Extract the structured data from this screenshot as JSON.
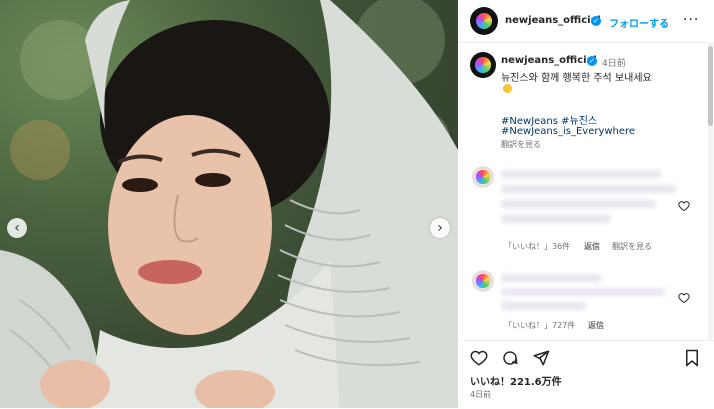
{
  "post": {
    "username": "newjeans_official",
    "follow_label": "フォローする",
    "more_label": "···",
    "caption_time": "4日前",
    "caption_text": "뉴진스와 함께 행복한 주석 보내세요",
    "hashtags_line1": "#NewJeans #뉴진스",
    "hashtags_line2": "#NewJeans_is_Everywhere",
    "translate_label": "翻訳を見る",
    "likes": "いいね！221.6万件",
    "date": "4日前"
  },
  "comments": [
    {
      "likes_label": "「いいね！」36件",
      "reply_label": "返信",
      "translate_label": "翻訳を見る"
    },
    {
      "likes_label": "「いいね！」727件",
      "reply_label": "返信"
    }
  ],
  "icons": {
    "verified": "✓",
    "prev": "‹",
    "next": "›"
  },
  "colors": {
    "accent": "#0095f6",
    "link": "#00376b"
  }
}
